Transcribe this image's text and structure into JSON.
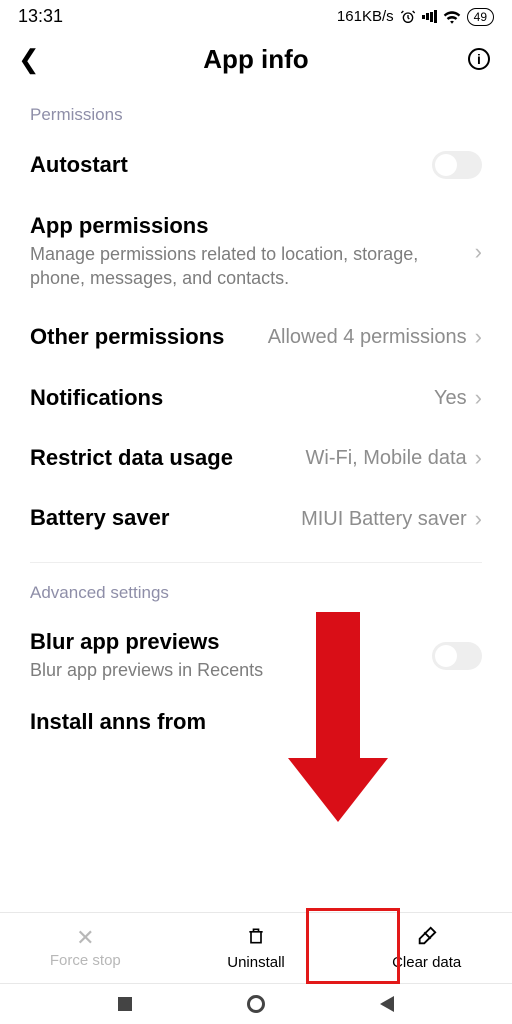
{
  "status": {
    "time": "13:31",
    "net": "161KB/s",
    "battery": "49"
  },
  "header": {
    "title": "App info"
  },
  "sections": {
    "permissions_label": "Permissions",
    "advanced_label": "Advanced settings"
  },
  "items": {
    "autostart": {
      "title": "Autostart"
    },
    "app_permissions": {
      "title": "App permissions",
      "subtitle": "Manage permissions related to location, storage, phone, messages, and contacts."
    },
    "other_permissions": {
      "title": "Other permissions",
      "value": "Allowed 4 permissions"
    },
    "notifications": {
      "title": "Notifications",
      "value": "Yes"
    },
    "restrict_data": {
      "title": "Restrict data usage",
      "value": "Wi-Fi, Mobile data"
    },
    "battery_saver": {
      "title": "Battery saver",
      "value": "MIUI Battery saver"
    },
    "blur_previews": {
      "title": "Blur app previews",
      "subtitle": "Blur app previews in Recents"
    },
    "install_from": {
      "title": "Install anns from"
    }
  },
  "bottombar": {
    "force_stop": "Force stop",
    "uninstall": "Uninstall",
    "clear_data": "Clear data"
  }
}
